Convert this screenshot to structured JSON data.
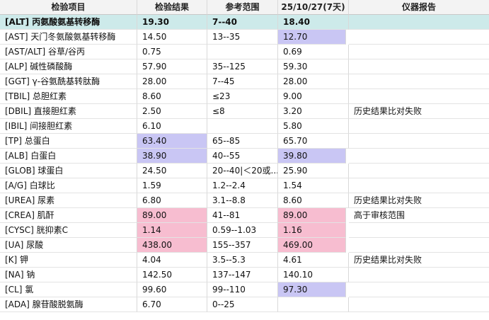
{
  "columns": [
    "检验项目",
    "检验结果",
    "参考范围",
    "25/10/27(7天)",
    "仪器报告"
  ],
  "rows": [
    {
      "item": "[ALT] 丙氨酸氨基转移酶",
      "result": "19.30",
      "range": "7--40",
      "prev": "18.40",
      "note": "",
      "selected": true
    },
    {
      "item": "[AST] 天门冬氨酸氨基转移酶",
      "result": "14.50",
      "range": "13--35",
      "prev": "12.70",
      "note": "",
      "prev_flag": "low"
    },
    {
      "item": "[AST/ALT] 谷草/谷丙",
      "result": "0.75",
      "range": "",
      "prev": "0.69",
      "note": ""
    },
    {
      "item": "[ALP] 碱性磷酸酶",
      "result": "57.90",
      "range": "35--125",
      "prev": "59.30",
      "note": ""
    },
    {
      "item": "[GGT] γ-谷氨酰基转肽酶",
      "result": "28.00",
      "range": "7--45",
      "prev": "28.00",
      "note": ""
    },
    {
      "item": "[TBIL] 总胆红素",
      "result": "8.60",
      "range": "≤23",
      "prev": "9.00",
      "note": ""
    },
    {
      "item": "[DBIL] 直接胆红素",
      "result": "2.50",
      "range": "≤8",
      "prev": "3.20",
      "note": "历史结果比对失败"
    },
    {
      "item": "[IBIL] 间接胆红素",
      "result": "6.10",
      "range": "",
      "prev": "5.80",
      "note": ""
    },
    {
      "item": "[TP] 总蛋白",
      "result": "63.40",
      "range": "65--85",
      "prev": "65.70",
      "note": "",
      "result_flag": "low"
    },
    {
      "item": "[ALB] 白蛋白",
      "result": "38.90",
      "range": "40--55",
      "prev": "39.80",
      "note": "",
      "result_flag": "low",
      "prev_flag": "low"
    },
    {
      "item": "[GLOB] 球蛋白",
      "result": "24.50",
      "range": "20--40|＜20或...",
      "prev": "25.90",
      "note": ""
    },
    {
      "item": "[A/G] 白球比",
      "result": "1.59",
      "range": "1.2--2.4",
      "prev": "1.54",
      "note": ""
    },
    {
      "item": "[UREA] 尿素",
      "result": "6.80",
      "range": "3.1--8.8",
      "prev": "8.60",
      "note": "历史结果比对失败"
    },
    {
      "item": "[CREA] 肌酐",
      "result": "89.00",
      "range": "41--81",
      "prev": "89.00",
      "note": "高于审核范围",
      "result_flag": "high",
      "prev_flag": "high"
    },
    {
      "item": "[CYSC] 胱抑素C",
      "result": "1.14",
      "range": "0.59--1.03",
      "prev": "1.16",
      "note": "",
      "result_flag": "high",
      "prev_flag": "high"
    },
    {
      "item": "[UA] 尿酸",
      "result": "438.00",
      "range": "155--357",
      "prev": "469.00",
      "note": "",
      "result_flag": "high",
      "prev_flag": "high"
    },
    {
      "item": "[K] 钾",
      "result": "4.04",
      "range": "3.5--5.3",
      "prev": "4.61",
      "note": "历史结果比对失败"
    },
    {
      "item": "[NA] 钠",
      "result": "142.50",
      "range": "137--147",
      "prev": "140.10",
      "note": ""
    },
    {
      "item": "[CL] 氯",
      "result": "99.60",
      "range": "99--110",
      "prev": "97.30",
      "note": "",
      "prev_flag": "low"
    },
    {
      "item": "[ADA] 腺苷酸脱氨酶",
      "result": "6.70",
      "range": "0--25",
      "prev": "",
      "note": ""
    }
  ],
  "colors": {
    "header_bg": "#f3f3f3",
    "selected_row": "#cdeaea",
    "low_flag": "#c9c6f4",
    "high_flag": "#f7bdd0"
  }
}
